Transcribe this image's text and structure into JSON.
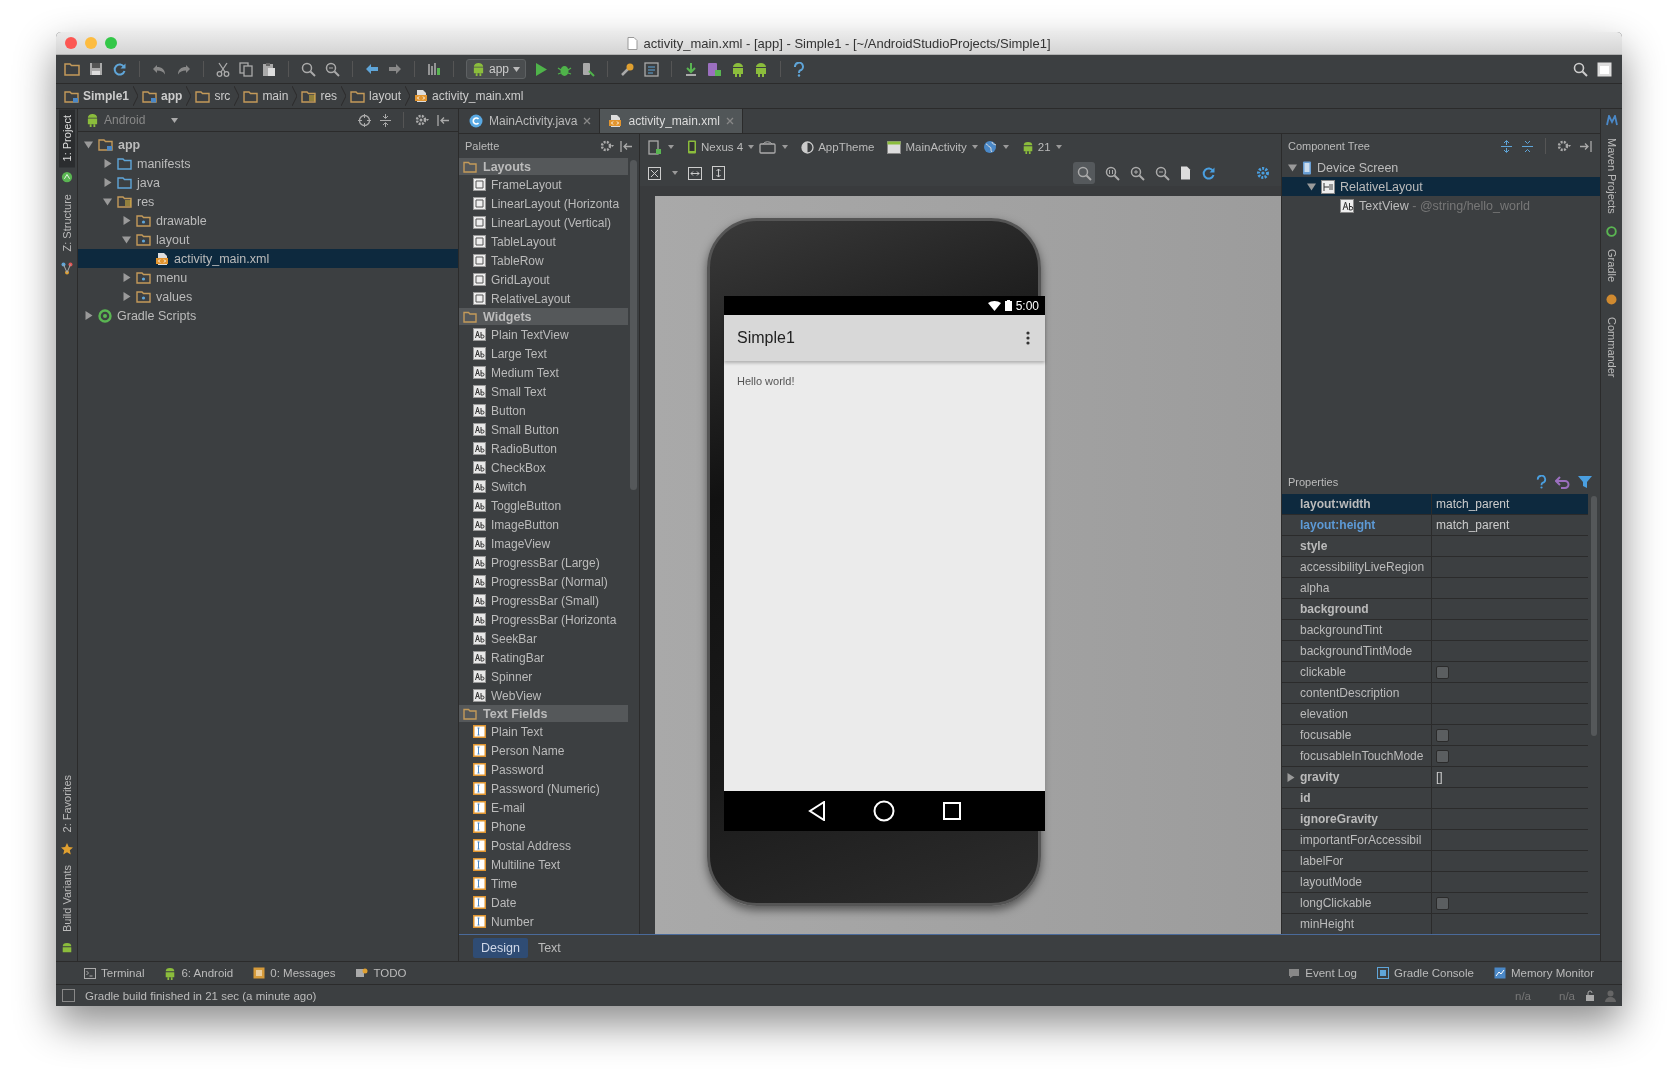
{
  "window": {
    "title": "activity_main.xml - [app] - Simple1 - [~/AndroidStudioProjects/Simple1]"
  },
  "toolbar": {
    "run_config": "app"
  },
  "breadcrumbs": [
    {
      "label": "Simple1",
      "kind": "module"
    },
    {
      "label": "app",
      "kind": "module"
    },
    {
      "label": "src",
      "kind": "folder"
    },
    {
      "label": "main",
      "kind": "folder"
    },
    {
      "label": "res",
      "kind": "res"
    },
    {
      "label": "layout",
      "kind": "folder"
    },
    {
      "label": "activity_main.xml",
      "kind": "xml"
    }
  ],
  "left_tool_windows": {
    "top": [
      {
        "label": "1: Project",
        "selected": true
      },
      {
        "label": "Z: Structure",
        "selected": false
      }
    ],
    "bottom": [
      {
        "label": "2: Favorites",
        "selected": false
      },
      {
        "label": "Build Variants",
        "selected": false
      }
    ]
  },
  "right_tool_windows": [
    {
      "label": "Maven Projects"
    },
    {
      "label": "Gradle"
    },
    {
      "label": "Commander"
    }
  ],
  "project": {
    "view": "Android",
    "tree": [
      {
        "label": "app",
        "kind": "module",
        "expanded": true,
        "selected": false,
        "children": [
          {
            "label": "manifests",
            "kind": "source",
            "expanded": false,
            "selected": false
          },
          {
            "label": "java",
            "kind": "source",
            "expanded": false,
            "selected": false
          },
          {
            "label": "res",
            "kind": "res",
            "expanded": true,
            "selected": false,
            "children": [
              {
                "label": "drawable",
                "kind": "resdir",
                "expanded": false,
                "selected": false
              },
              {
                "label": "layout",
                "kind": "resdir",
                "expanded": true,
                "selected": false,
                "children": [
                  {
                    "label": "activity_main.xml",
                    "kind": "xml",
                    "selected": true
                  }
                ]
              },
              {
                "label": "menu",
                "kind": "resdir",
                "expanded": false,
                "selected": false
              },
              {
                "label": "values",
                "kind": "resdir",
                "expanded": false,
                "selected": false
              }
            ]
          }
        ]
      },
      {
        "label": "Gradle Scripts",
        "kind": "gradle",
        "expanded": false,
        "selected": false
      }
    ]
  },
  "editor_tabs": [
    {
      "label": "MainActivity.java",
      "kind": "java",
      "selected": false
    },
    {
      "label": "activity_main.xml",
      "kind": "xml",
      "selected": true
    }
  ],
  "palette": {
    "title": "Palette",
    "groups": [
      {
        "label": "Layouts",
        "kind": "layout",
        "items": [
          "FrameLayout",
          "LinearLayout (Horizonta",
          "LinearLayout (Vertical)",
          "TableLayout",
          "TableRow",
          "GridLayout",
          "RelativeLayout"
        ]
      },
      {
        "label": "Widgets",
        "kind": "widget",
        "items": [
          "Plain TextView",
          "Large Text",
          "Medium Text",
          "Small Text",
          "Button",
          "Small Button",
          "RadioButton",
          "CheckBox",
          "Switch",
          "ToggleButton",
          "ImageButton",
          "ImageView",
          "ProgressBar (Large)",
          "ProgressBar (Normal)",
          "ProgressBar (Small)",
          "ProgressBar (Horizonta",
          "SeekBar",
          "RatingBar",
          "Spinner",
          "WebView"
        ]
      },
      {
        "label": "Text Fields",
        "kind": "textfield",
        "items": [
          "Plain Text",
          "Person Name",
          "Password",
          "Password (Numeric)",
          "E-mail",
          "Phone",
          "Postal Address",
          "Multiline Text",
          "Time",
          "Date",
          "Number"
        ]
      }
    ]
  },
  "designer": {
    "device": "Nexus 4",
    "theme": "AppTheme",
    "activity": "MainActivity",
    "api": "21",
    "phone": {
      "time": "5:00",
      "app_title": "Simple1",
      "content": "Hello world!"
    }
  },
  "component_tree": {
    "title": "Component Tree",
    "nodes": [
      {
        "label": "Device Screen",
        "kind": "device",
        "expanded": true,
        "selected": false,
        "children": [
          {
            "label": "RelativeLayout",
            "kind": "layout",
            "expanded": true,
            "selected": true,
            "children": [
              {
                "label": "TextView",
                "detail": "- @string/hello_world",
                "kind": "text",
                "selected": false
              }
            ]
          }
        ]
      }
    ]
  },
  "properties": {
    "title": "Properties",
    "rows": [
      {
        "name": "layout:width",
        "value": "match_parent",
        "kind": "text",
        "bold": true,
        "modified": false,
        "selected": true
      },
      {
        "name": "layout:height",
        "value": "match_parent",
        "kind": "text",
        "bold": true,
        "modified": true,
        "selected": false
      },
      {
        "name": "style",
        "kind": "text",
        "bold": true,
        "modified": false,
        "selected": false
      },
      {
        "name": "accessibilityLiveRegion",
        "kind": "text",
        "bold": false,
        "modified": false,
        "selected": false
      },
      {
        "name": "alpha",
        "kind": "text",
        "bold": false,
        "modified": false,
        "selected": false
      },
      {
        "name": "background",
        "kind": "text",
        "bold": true,
        "modified": false,
        "selected": false
      },
      {
        "name": "backgroundTint",
        "kind": "text",
        "bold": false,
        "modified": false,
        "selected": false
      },
      {
        "name": "backgroundTintMode",
        "kind": "text",
        "bold": false,
        "modified": false,
        "selected": false
      },
      {
        "name": "clickable",
        "kind": "checkbox",
        "checked": false,
        "bold": false,
        "modified": false,
        "selected": false
      },
      {
        "name": "contentDescription",
        "kind": "text",
        "bold": false,
        "modified": false,
        "selected": false
      },
      {
        "name": "elevation",
        "kind": "text",
        "bold": false,
        "modified": false,
        "selected": false
      },
      {
        "name": "focusable",
        "kind": "checkbox",
        "checked": false,
        "bold": false,
        "modified": false,
        "selected": false
      },
      {
        "name": "focusableInTouchMode",
        "kind": "checkbox",
        "checked": false,
        "bold": false,
        "modified": false,
        "selected": false
      },
      {
        "name": "gravity",
        "value": "[]",
        "kind": "flags",
        "expanded": false,
        "bold": true,
        "modified": false,
        "selected": false
      },
      {
        "name": "id",
        "kind": "text",
        "bold": true,
        "modified": false,
        "selected": false
      },
      {
        "name": "ignoreGravity",
        "kind": "text",
        "bold": true,
        "modified": false,
        "selected": false
      },
      {
        "name": "importantForAccessibil",
        "kind": "text",
        "bold": false,
        "modified": false,
        "selected": false
      },
      {
        "name": "labelFor",
        "kind": "text",
        "bold": false,
        "modified": false,
        "selected": false
      },
      {
        "name": "layoutMode",
        "kind": "text",
        "bold": false,
        "modified": false,
        "selected": false
      },
      {
        "name": "longClickable",
        "kind": "checkbox",
        "checked": false,
        "bold": false,
        "modified": false,
        "selected": false
      },
      {
        "name": "minHeight",
        "kind": "text",
        "bold": false,
        "modified": false,
        "selected": false
      }
    ]
  },
  "design_tabs": [
    {
      "label": "Design",
      "selected": true
    },
    {
      "label": "Text",
      "selected": false
    }
  ],
  "bottom_bar": {
    "left": [
      {
        "label": "Terminal",
        "kind": "terminal"
      },
      {
        "label": "6: Android",
        "kind": "android"
      },
      {
        "label": "0: Messages",
        "kind": "messages"
      },
      {
        "label": "TODO",
        "kind": "todo"
      }
    ],
    "right": [
      {
        "label": "Event Log",
        "kind": "log"
      },
      {
        "label": "Gradle Console",
        "kind": "console"
      },
      {
        "label": "Memory Monitor",
        "kind": "memory"
      }
    ]
  },
  "status_bar": {
    "message": "Gradle build finished in 21 sec (a minute ago)",
    "fields": [
      "n/a",
      "n/a"
    ]
  }
}
